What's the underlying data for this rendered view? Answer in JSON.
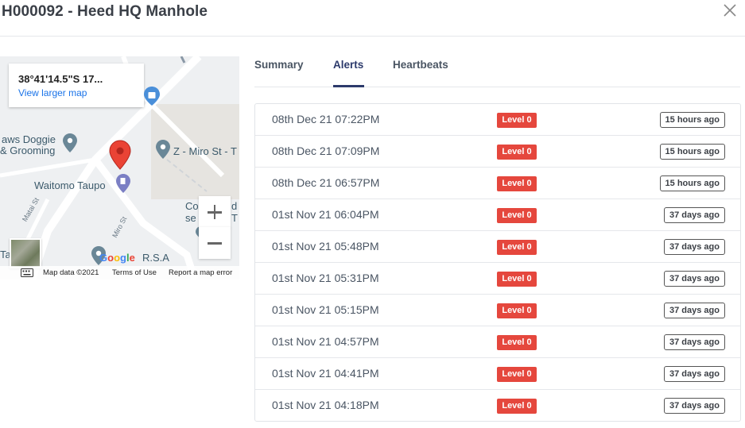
{
  "modal": {
    "title": "H000092 - Heed HQ Manhole"
  },
  "map": {
    "coordinates": "38°41'14.5\"S 17...",
    "view_larger": "View larger map",
    "labels": {
      "dog_grooming_1": "aws Doggie",
      "dog_grooming_2": "& Grooming",
      "miro_place": "Z - Miro St - T",
      "waitomo": "Waitomo Taupo",
      "co_1": "Co",
      "co_2": "se",
      "rsa": "R.S.A",
      "ta_left": "Ta",
      "d_right": "d",
      "t_right": "T",
      "matai_st": "Matai St",
      "miro_st": "Miro St"
    },
    "zoom_in": "+",
    "zoom_out": "−",
    "google": "Google",
    "footer": {
      "map_data": "Map data ©2021",
      "terms": "Terms of Use",
      "report": "Report a map error"
    },
    "colors": {
      "marker": "#ea4335",
      "poi": "#5f7e90",
      "road": "#ffffff",
      "background": "#eef0f2"
    }
  },
  "tabs": [
    {
      "label": "Summary",
      "active": false
    },
    {
      "label": "Alerts",
      "active": true
    },
    {
      "label": "Heartbeats",
      "active": false
    }
  ],
  "alerts": [
    {
      "date": "08th Dec 21 07:22PM",
      "level": "Level 0",
      "ago": "15 hours ago"
    },
    {
      "date": "08th Dec 21 07:09PM",
      "level": "Level 0",
      "ago": "15 hours ago"
    },
    {
      "date": "08th Dec 21 06:57PM",
      "level": "Level 0",
      "ago": "15 hours ago"
    },
    {
      "date": "01st Nov 21 06:04PM",
      "level": "Level 0",
      "ago": "37 days ago"
    },
    {
      "date": "01st Nov 21 05:48PM",
      "level": "Level 0",
      "ago": "37 days ago"
    },
    {
      "date": "01st Nov 21 05:31PM",
      "level": "Level 0",
      "ago": "37 days ago"
    },
    {
      "date": "01st Nov 21 05:15PM",
      "level": "Level 0",
      "ago": "37 days ago"
    },
    {
      "date": "01st Nov 21 04:57PM",
      "level": "Level 0",
      "ago": "37 days ago"
    },
    {
      "date": "01st Nov 21 04:41PM",
      "level": "Level 0",
      "ago": "37 days ago"
    },
    {
      "date": "01st Nov 21 04:18PM",
      "level": "Level 0",
      "ago": "37 days ago"
    }
  ],
  "colors": {
    "level_badge": "#e5473d",
    "active_tab": "#2c3a6b"
  }
}
